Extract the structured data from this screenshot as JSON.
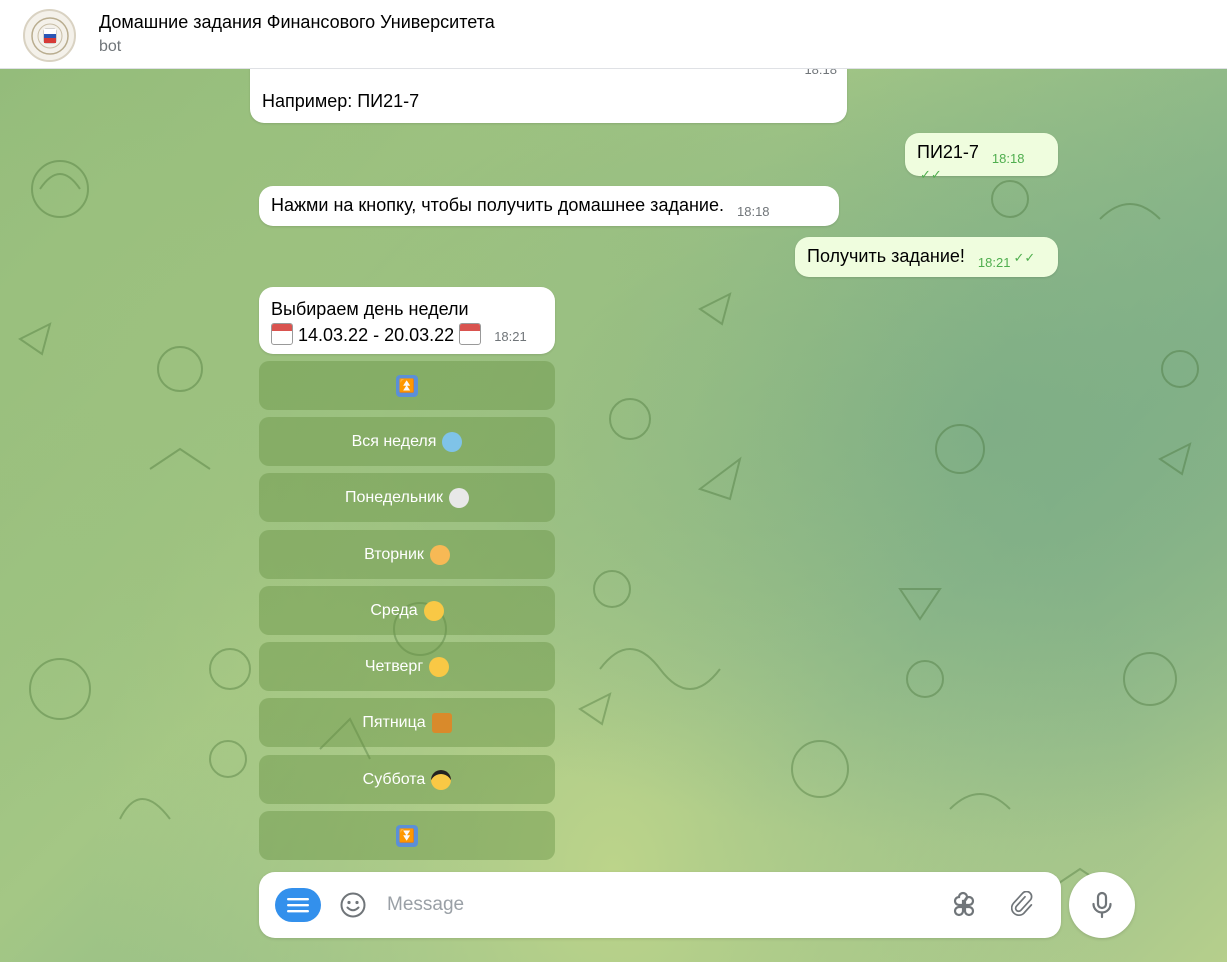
{
  "header": {
    "title": "Домашние задания Финансового Университета",
    "subtitle": "bot"
  },
  "messages": [
    {
      "text": "Например: ПИ21-7",
      "time": "18:18",
      "direction": "in"
    },
    {
      "text": "ПИ21-7",
      "time": "18:18",
      "direction": "out"
    },
    {
      "text": "Нажми на кнопку, чтобы получить домашнее задание.",
      "time": "18:18",
      "direction": "in"
    },
    {
      "text": "Получить задание!",
      "time": "18:21",
      "direction": "out"
    },
    {
      "line1": "Выбираем день недели",
      "line2": "14.03.22 - 20.03.22",
      "time": "18:21",
      "direction": "in"
    }
  ],
  "keyboard": [
    {
      "label": "",
      "icon": "up-arrow-icon"
    },
    {
      "label": "Вся неделя",
      "icon": "cold-face-emoji"
    },
    {
      "label": "Понедельник",
      "icon": "skull-emoji"
    },
    {
      "label": "Вторник",
      "icon": "exploding-head-emoji"
    },
    {
      "label": "Среда",
      "icon": "relieved-face-emoji"
    },
    {
      "label": "Четверг",
      "icon": "neutral-face-emoji"
    },
    {
      "label": "Пятница",
      "icon": "beer-mug-emoji"
    },
    {
      "label": "Суббота",
      "icon": "sunglasses-face-emoji"
    },
    {
      "label": "",
      "icon": "down-arrow-icon"
    }
  ],
  "composer": {
    "placeholder": "Message"
  },
  "colors": {
    "accent": "#3390ec",
    "outgoing_bubble": "#effdde",
    "check_green": "#4fae4e"
  }
}
